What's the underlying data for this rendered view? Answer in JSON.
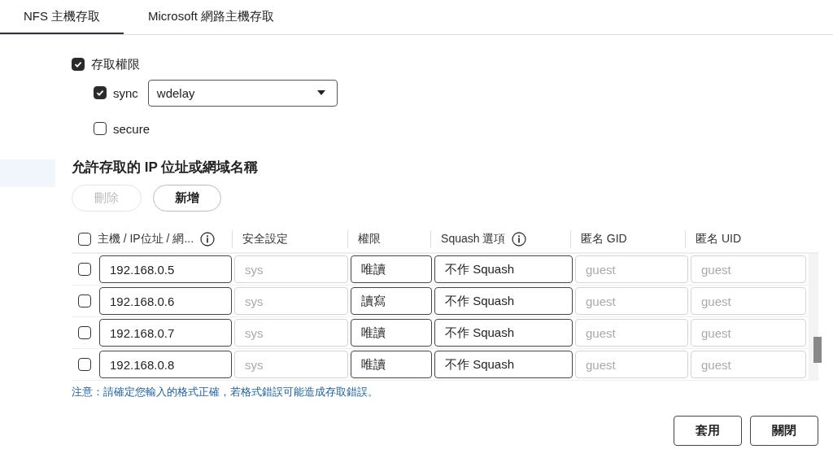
{
  "tabs": [
    {
      "label": "NFS 主機存取",
      "selected": true
    },
    {
      "label": "Microsoft 網路主機存取",
      "selected": false
    }
  ],
  "options": [
    {
      "kind": "checkbox",
      "label": "存取權限",
      "checked": true,
      "nested": false
    },
    {
      "kind": "checkbox-select",
      "label": "sync",
      "checked": true,
      "nested": true,
      "select_value": "wdelay"
    },
    {
      "kind": "checkbox",
      "label": "secure",
      "checked": false,
      "nested": true
    }
  ],
  "section_title": "允許存取的 IP 位址或網域名稱",
  "actions": [
    {
      "label": "刪除",
      "disabled": true
    },
    {
      "label": "新增",
      "disabled": false
    }
  ],
  "table": {
    "select_all_checked": false,
    "columns": [
      {
        "label": "主機 / IP位址 / 網...",
        "info": true
      },
      {
        "label": "安全設定",
        "info": false
      },
      {
        "label": "權限",
        "info": false
      },
      {
        "label": "Squash 選項",
        "info": true
      },
      {
        "label": "匿名 GID",
        "info": false
      },
      {
        "label": "匿名 UID",
        "info": false
      }
    ],
    "rows": [
      {
        "checked": false,
        "host": "192.168.0.5",
        "security_placeholder": "sys",
        "permission": "唯讀",
        "squash": "不作 Squash",
        "gid_placeholder": "guest",
        "uid_placeholder": "guest"
      },
      {
        "checked": false,
        "host": "192.168.0.6",
        "security_placeholder": "sys",
        "permission": "讀寫",
        "squash": "不作 Squash",
        "gid_placeholder": "guest",
        "uid_placeholder": "guest"
      },
      {
        "checked": false,
        "host": "192.168.0.7",
        "security_placeholder": "sys",
        "permission": "唯讀",
        "squash": "不作 Squash",
        "gid_placeholder": "guest",
        "uid_placeholder": "guest"
      },
      {
        "checked": false,
        "host": "192.168.0.8",
        "security_placeholder": "sys",
        "permission": "唯讀",
        "squash": "不作 Squash",
        "gid_placeholder": "guest",
        "uid_placeholder": "guest"
      }
    ]
  },
  "note": "注意：請確定您輸入的格式正確，若格式錯誤可能造成存取錯誤。",
  "footer_buttons": [
    {
      "label": "套用"
    },
    {
      "label": "關閉"
    }
  ]
}
